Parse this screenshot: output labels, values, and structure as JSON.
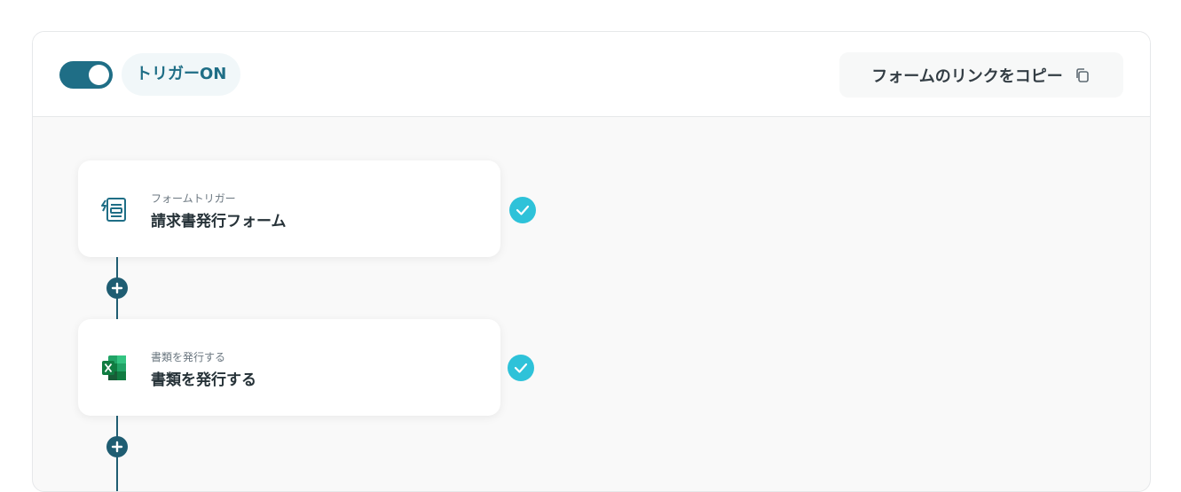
{
  "header": {
    "trigger_label": "トリガーON",
    "toggle_state": "on",
    "copy_link_label": "フォームのリンクをコピー",
    "copy_icon": "copy-icon"
  },
  "flow": {
    "steps": [
      {
        "icon": "form-icon",
        "subtitle": "フォームトリガー",
        "title": "請求書発行フォーム",
        "status": "completed"
      },
      {
        "icon": "excel-icon",
        "subtitle": "書類を発行する",
        "title": "書類を発行する",
        "status": "completed"
      }
    ]
  },
  "colors": {
    "accent": "#1f6e86",
    "check": "#2ec2d9",
    "highlight": "#e0242b"
  }
}
